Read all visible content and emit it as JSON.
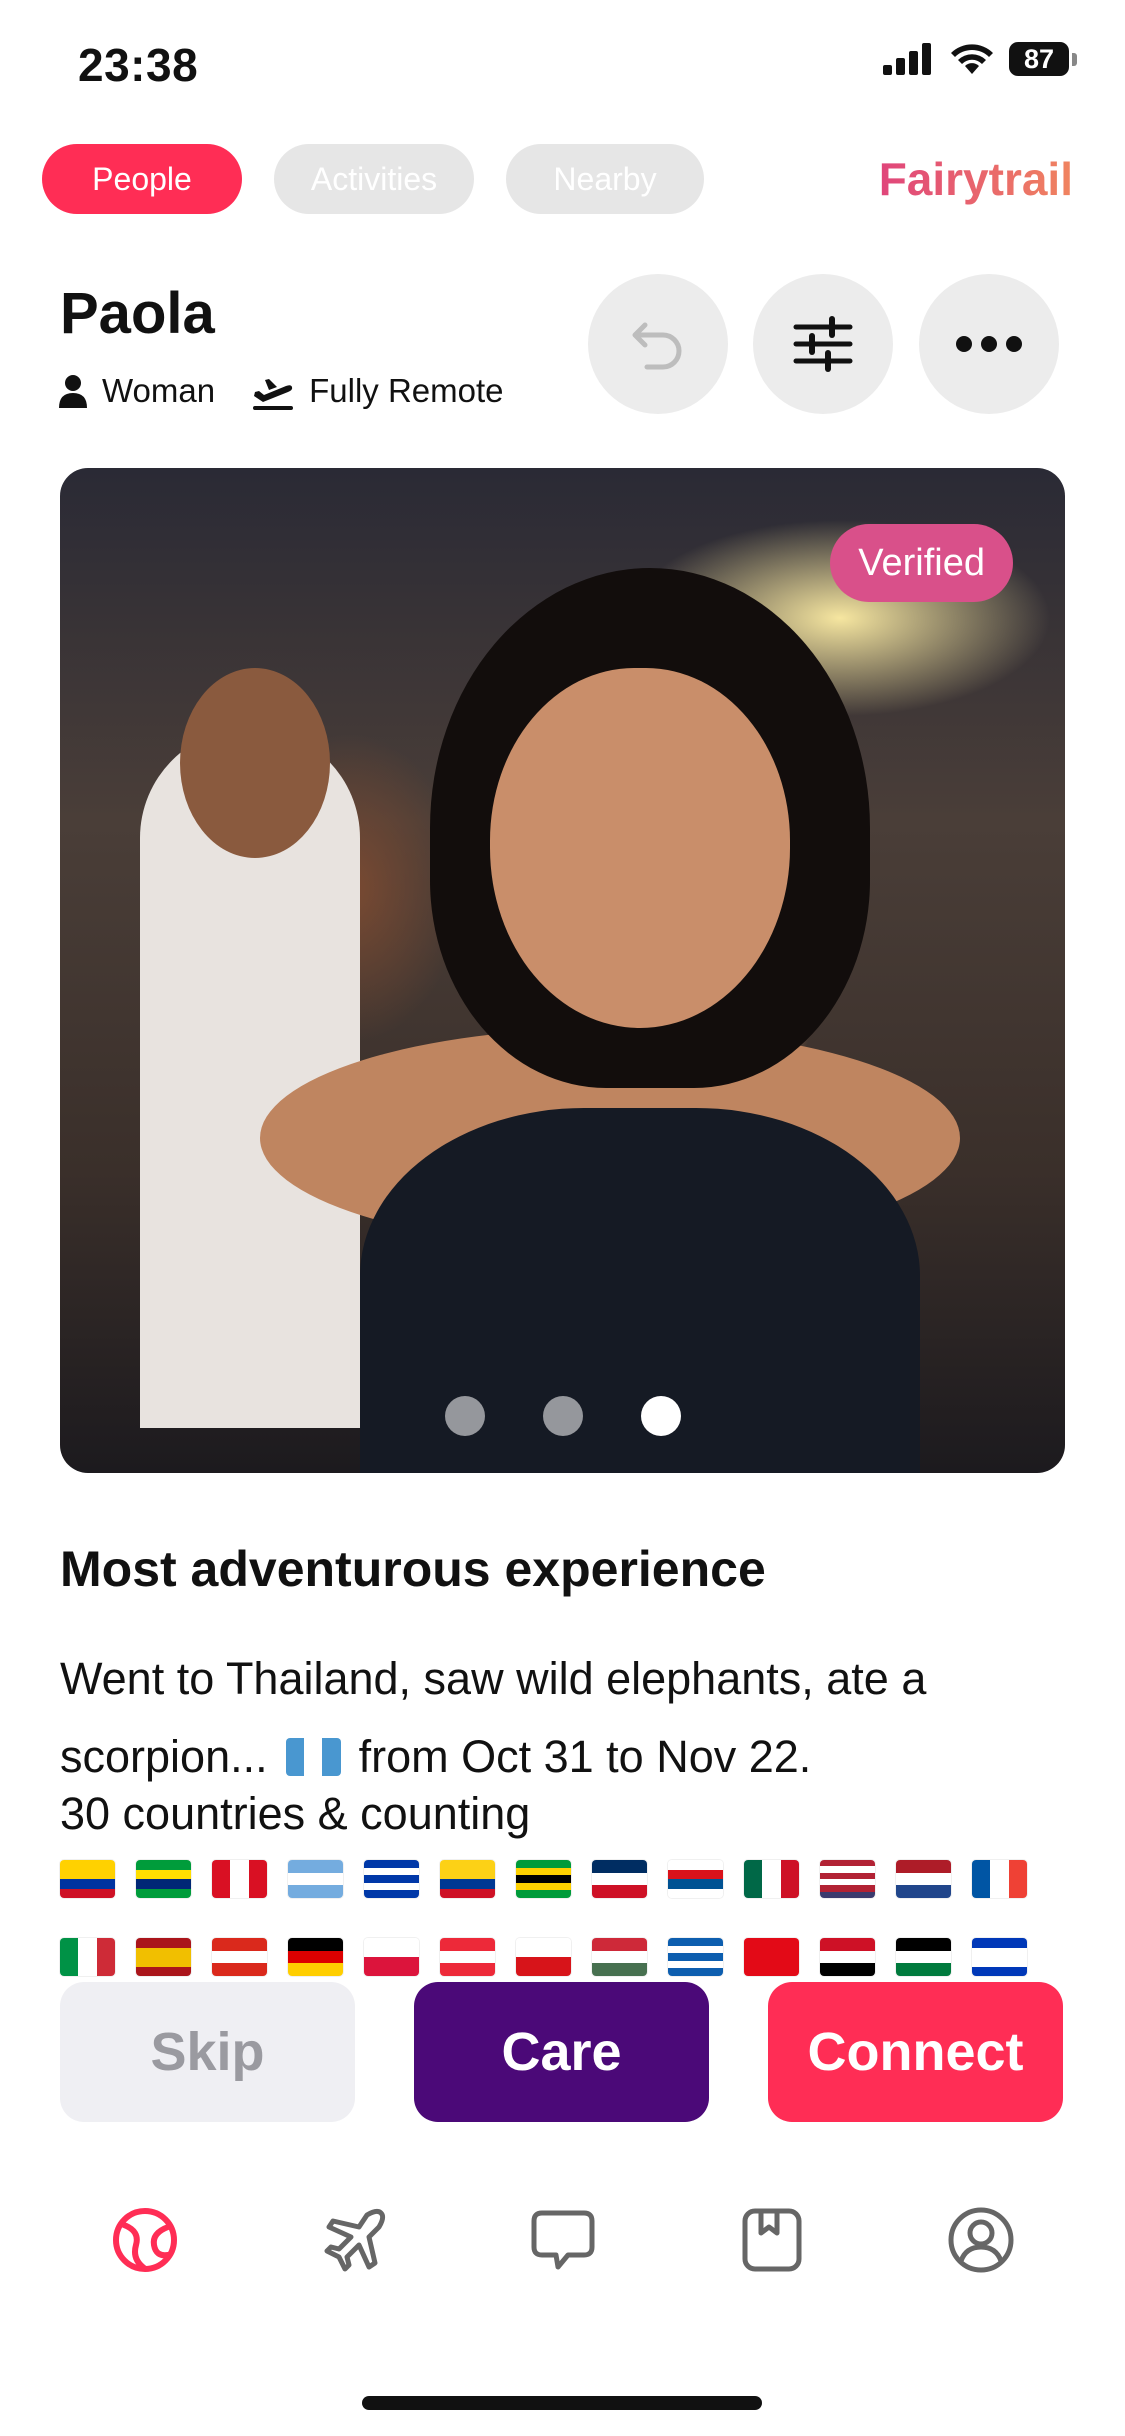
{
  "status_bar": {
    "time": "23:38",
    "battery": "87"
  },
  "tabs": [
    {
      "label": "People",
      "active": true
    },
    {
      "label": "Activities",
      "active": false
    },
    {
      "label": "Nearby",
      "active": false
    }
  ],
  "brand": "Fairytrail",
  "profile": {
    "name": "Paola",
    "gender": "Woman",
    "work": "Fully Remote",
    "badge": "Verified",
    "photo_count": 3,
    "active_photo": 3
  },
  "prompt": {
    "title": "Most adventurous experience",
    "answer_line1": "Went to Thailand, saw wild elephants, ate a",
    "answer_line2_prefix": "scorpion...",
    "answer_line2_suffix": "from Oct 31 to Nov 22."
  },
  "countries_label": "30 countries & counting",
  "flags": [
    {
      "name": "Ecuador",
      "dir": "h",
      "colors": [
        "#ffd100",
        "#ffd100",
        "#0033a0",
        "#ce1126"
      ]
    },
    {
      "name": "Brazil",
      "dir": "h",
      "colors": [
        "#009c3b",
        "#ffdf00",
        "#002776",
        "#009c3b"
      ]
    },
    {
      "name": "Peru",
      "dir": "v",
      "colors": [
        "#d91023",
        "#ffffff",
        "#d91023"
      ]
    },
    {
      "name": "Argentina",
      "dir": "h",
      "colors": [
        "#74acdf",
        "#ffffff",
        "#74acdf"
      ]
    },
    {
      "name": "Uruguay",
      "dir": "h",
      "colors": [
        "#0038a8",
        "#ffffff",
        "#0038a8",
        "#ffffff",
        "#0038a8"
      ]
    },
    {
      "name": "Colombia",
      "dir": "h",
      "colors": [
        "#fcd116",
        "#fcd116",
        "#003893",
        "#ce1126"
      ]
    },
    {
      "name": "Jamaica",
      "dir": "h",
      "colors": [
        "#009b3a",
        "#fed100",
        "#000000",
        "#fed100",
        "#009b3a"
      ]
    },
    {
      "name": "Dominican Republic",
      "dir": "h",
      "colors": [
        "#002d62",
        "#ffffff",
        "#ce1126"
      ]
    },
    {
      "name": "Panama",
      "dir": "h",
      "colors": [
        "#ffffff",
        "#da121a",
        "#005293",
        "#ffffff"
      ]
    },
    {
      "name": "Mexico",
      "dir": "v",
      "colors": [
        "#006847",
        "#ffffff",
        "#ce1126"
      ]
    },
    {
      "name": "United States",
      "dir": "h",
      "colors": [
        "#b22234",
        "#ffffff",
        "#b22234",
        "#ffffff",
        "#b22234",
        "#3c3b6e"
      ]
    },
    {
      "name": "Netherlands",
      "dir": "h",
      "colors": [
        "#ae1c28",
        "#ffffff",
        "#21468b"
      ]
    },
    {
      "name": "France",
      "dir": "v",
      "colors": [
        "#0055a4",
        "#ffffff",
        "#ef4135"
      ]
    },
    {
      "name": "Italy",
      "dir": "v",
      "colors": [
        "#009246",
        "#ffffff",
        "#ce2b37"
      ]
    },
    {
      "name": "Spain",
      "dir": "h",
      "colors": [
        "#aa151b",
        "#f1bf00",
        "#f1bf00",
        "#aa151b"
      ]
    },
    {
      "name": "Switzerland",
      "dir": "h",
      "colors": [
        "#da291c",
        "#ffffff",
        "#da291c"
      ]
    },
    {
      "name": "Germany",
      "dir": "h",
      "colors": [
        "#000000",
        "#dd0000",
        "#ffce00"
      ]
    },
    {
      "name": "Poland",
      "dir": "h",
      "colors": [
        "#ffffff",
        "#dc143c"
      ]
    },
    {
      "name": "Austria",
      "dir": "h",
      "colors": [
        "#ed2939",
        "#ffffff",
        "#ed2939"
      ]
    },
    {
      "name": "Czechia",
      "dir": "h",
      "colors": [
        "#ffffff",
        "#d7141a"
      ]
    },
    {
      "name": "Hungary",
      "dir": "h",
      "colors": [
        "#ce2939",
        "#ffffff",
        "#477050"
      ]
    },
    {
      "name": "Greece",
      "dir": "h",
      "colors": [
        "#0d5eaf",
        "#ffffff",
        "#0d5eaf",
        "#ffffff",
        "#0d5eaf"
      ]
    },
    {
      "name": "Turkey",
      "dir": "h",
      "colors": [
        "#e30a17",
        "#e30a17"
      ]
    },
    {
      "name": "Egypt",
      "dir": "h",
      "colors": [
        "#ce1126",
        "#ffffff",
        "#000000"
      ]
    },
    {
      "name": "Jordan",
      "dir": "h",
      "colors": [
        "#000000",
        "#ffffff",
        "#007a3d"
      ]
    },
    {
      "name": "Israel",
      "dir": "h",
      "colors": [
        "#0038b8",
        "#ffffff",
        "#ffffff",
        "#0038b8"
      ]
    }
  ],
  "actions": {
    "skip": "Skip",
    "care": "Care",
    "connect": "Connect"
  },
  "nav": [
    "discover-icon",
    "trips-icon",
    "chat-icon",
    "saved-icon",
    "profile-icon"
  ],
  "colors": {
    "accent": "#ff2d55",
    "care": "#4b0978",
    "verified": "#d9508a"
  }
}
